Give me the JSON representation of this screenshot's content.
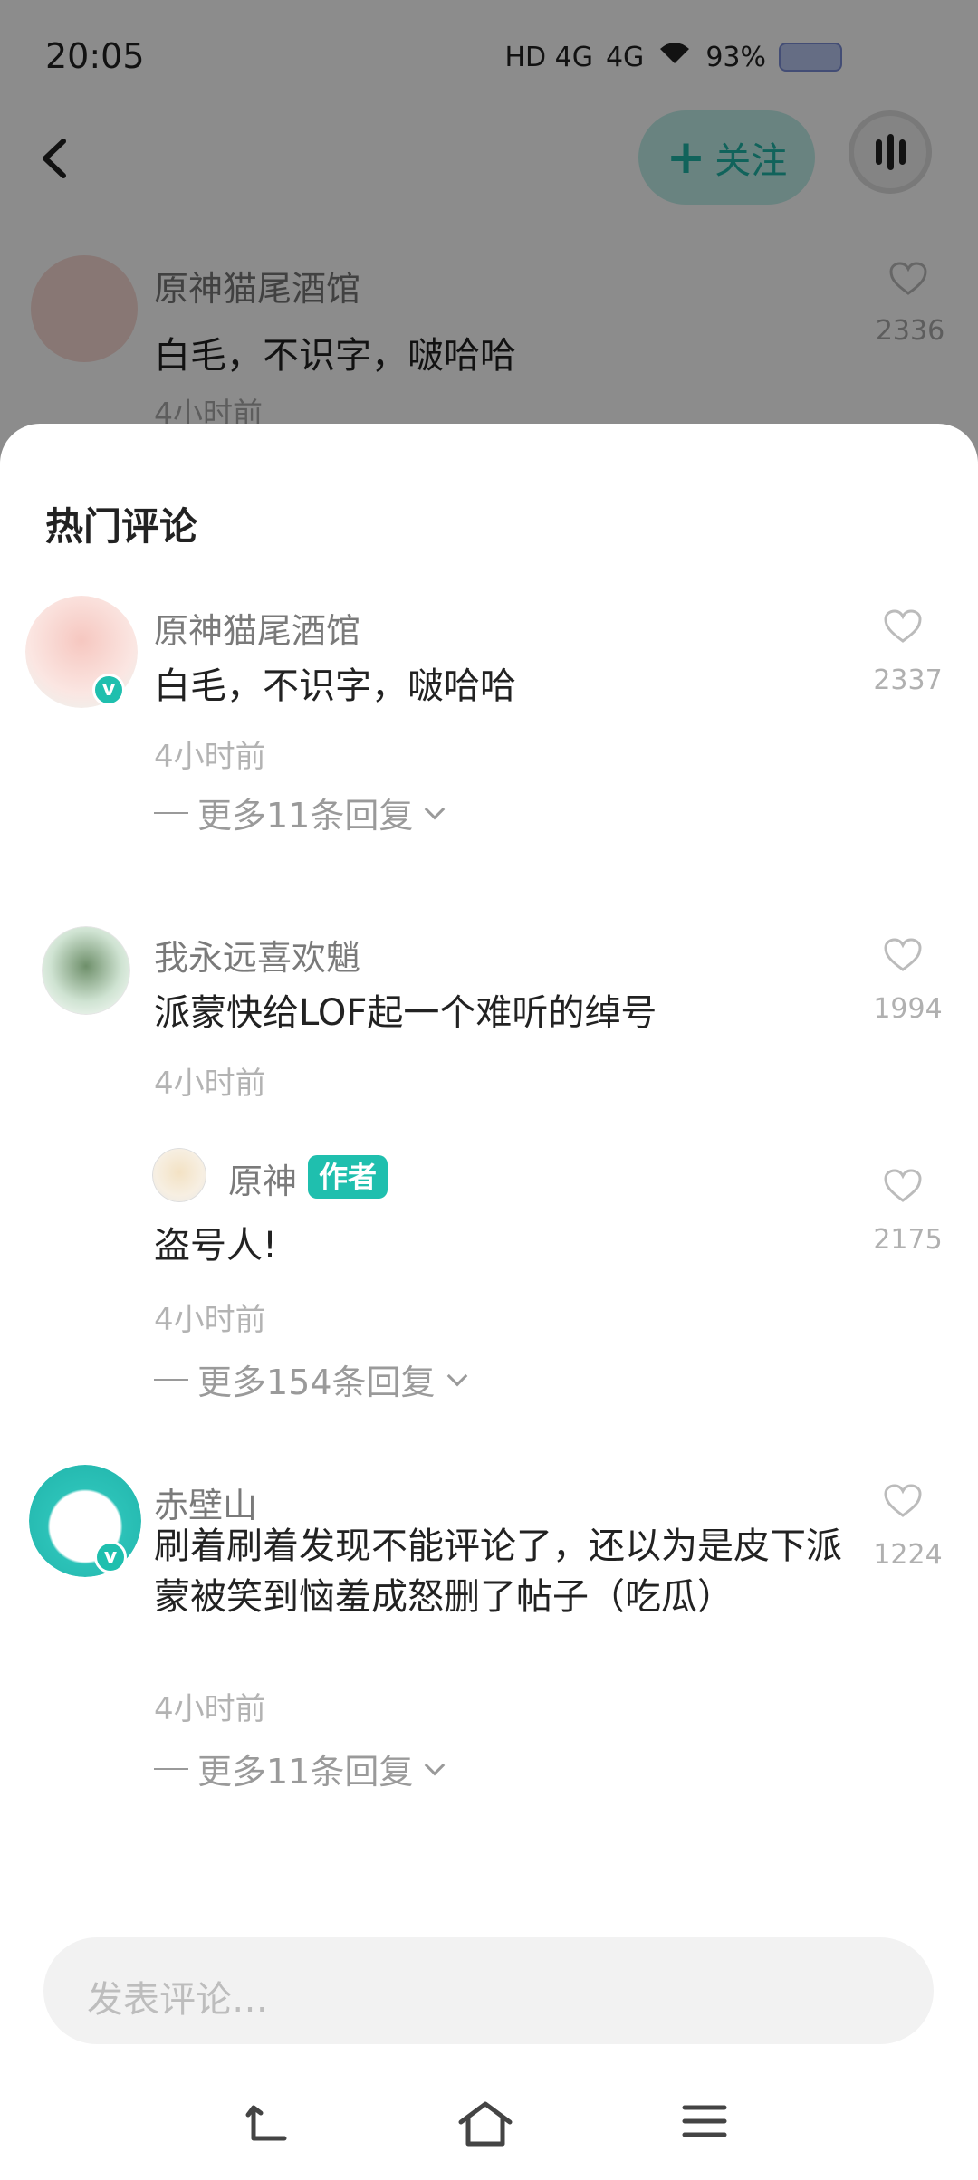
{
  "status_bar": {
    "time": "20:05",
    "network_1": "HD 4G",
    "network_2": "4G",
    "battery": "93%"
  },
  "top_bar": {
    "follow_label": "关注"
  },
  "background_comment": {
    "name": "原神猫尾酒馆",
    "text": "白毛，不识字，啵哈哈",
    "time": "4小时前",
    "likes": "2336"
  },
  "sheet": {
    "title": "热门评论",
    "comments": [
      {
        "name": "原神猫尾酒馆",
        "text": "白毛，不识字，啵哈哈",
        "time": "4小时前",
        "likes": "2337",
        "more": "更多11条回复"
      },
      {
        "name": "我永远喜欢魈",
        "text": "派蒙快给LOF起一个难听的绰号",
        "time": "4小时前",
        "likes": "1994"
      },
      {
        "name": "原神",
        "badge": "作者",
        "text": "盗号人!",
        "time": "4小时前",
        "likes": "2175",
        "more": "更多154条回复"
      },
      {
        "name": "赤壁山",
        "text": "刷着刷着发现不能评论了，还以为是皮下派蒙被笑到恼羞成怒删了帖子（吃瓜）",
        "time": "4小时前",
        "likes": "1224",
        "more": "更多11条回复"
      }
    ]
  },
  "input": {
    "placeholder": "发表评论…"
  },
  "colors": {
    "accent": "#1fbfae",
    "follow_bg": "#bfeee9"
  }
}
